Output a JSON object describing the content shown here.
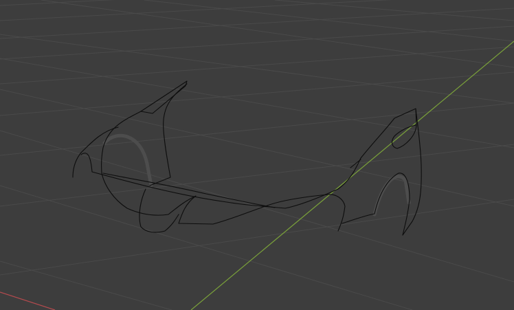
{
  "viewport": {
    "name": "3D Viewport",
    "view": "perspective",
    "background_color": "#3d3d3d",
    "grid": {
      "visible": true,
      "line_color": "#4a4a4a"
    },
    "axes": {
      "x_axis_color": "#b34a4e",
      "y_axis_color": "#7aa13a"
    },
    "objects": [
      {
        "type": "curve",
        "display": "wireframe",
        "description_icon": "curve-object-icon",
        "wire_color": "#0d0d0d",
        "shading_color": "#4d4d4d"
      }
    ]
  }
}
